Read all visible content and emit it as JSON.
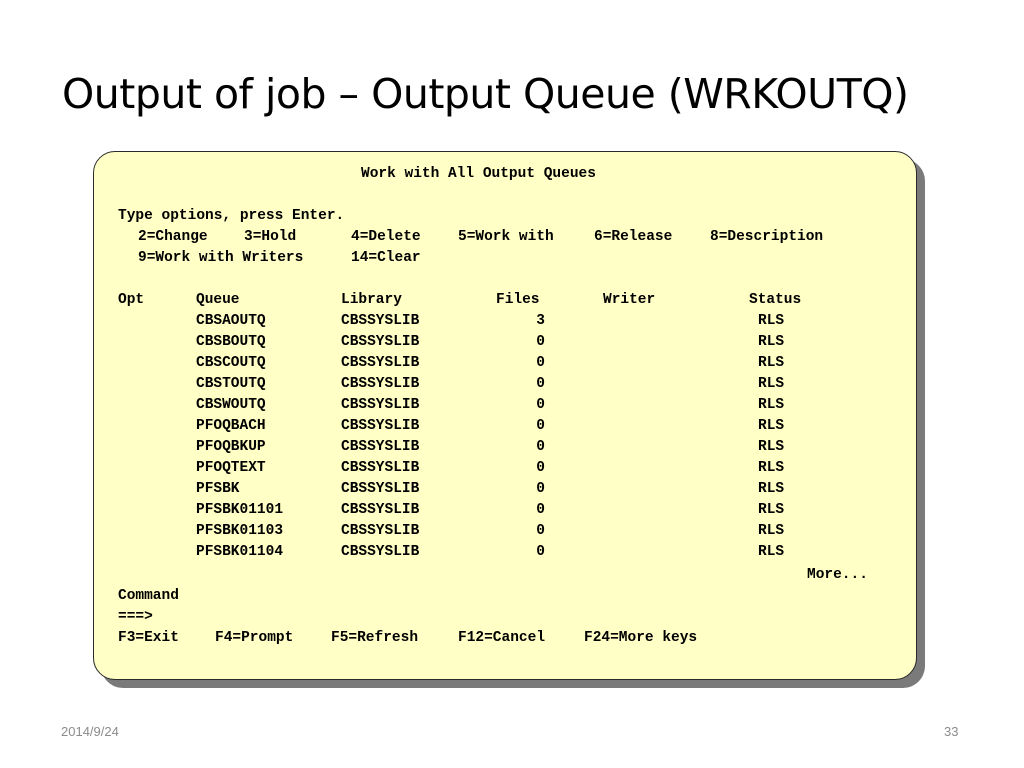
{
  "slide": {
    "title": "Output of job – Output Queue (WRKOUTQ)",
    "date": "2014/9/24",
    "page_number": "33"
  },
  "screen": {
    "title": "Work with All Output Queues",
    "instructions": "Type options, press Enter.",
    "options_line1": [
      "2=Change",
      "3=Hold",
      "4=Delete",
      "5=Work with",
      "6=Release",
      "8=Description"
    ],
    "options_line2": [
      "9=Work with Writers",
      "14=Clear"
    ],
    "columns": {
      "opt": "Opt",
      "queue": "Queue",
      "library": "Library",
      "files": "Files",
      "writer": "Writer",
      "status": "Status"
    },
    "rows": [
      {
        "queue": "CBSAOUTQ",
        "library": "CBSSYSLIB",
        "files": "3",
        "writer": "",
        "status": "RLS"
      },
      {
        "queue": "CBSBOUTQ",
        "library": "CBSSYSLIB",
        "files": "0",
        "writer": "",
        "status": "RLS"
      },
      {
        "queue": "CBSCOUTQ",
        "library": "CBSSYSLIB",
        "files": "0",
        "writer": "",
        "status": "RLS"
      },
      {
        "queue": "CBSTOUTQ",
        "library": "CBSSYSLIB",
        "files": "0",
        "writer": "",
        "status": "RLS"
      },
      {
        "queue": "CBSWOUTQ",
        "library": "CBSSYSLIB",
        "files": "0",
        "writer": "",
        "status": "RLS"
      },
      {
        "queue": "PFOQBACH",
        "library": "CBSSYSLIB",
        "files": "0",
        "writer": "",
        "status": "RLS"
      },
      {
        "queue": "PFOQBKUP",
        "library": "CBSSYSLIB",
        "files": "0",
        "writer": "",
        "status": "RLS"
      },
      {
        "queue": "PFOQTEXT",
        "library": "CBSSYSLIB",
        "files": "0",
        "writer": "",
        "status": "RLS"
      },
      {
        "queue": "PFSBK",
        "library": "CBSSYSLIB",
        "files": "0",
        "writer": "",
        "status": "RLS"
      },
      {
        "queue": "PFSBK01101",
        "library": "CBSSYSLIB",
        "files": "0",
        "writer": "",
        "status": "RLS"
      },
      {
        "queue": "PFSBK01103",
        "library": "CBSSYSLIB",
        "files": "0",
        "writer": "",
        "status": "RLS"
      },
      {
        "queue": "PFSBK01104",
        "library": "CBSSYSLIB",
        "files": "0",
        "writer": "",
        "status": "RLS"
      }
    ],
    "more_indicator": "More...",
    "command_label": "Command",
    "command_prompt": "===>",
    "command_value": "",
    "function_keys": [
      "F3=Exit",
      "F4=Prompt",
      "F5=Refresh",
      "F12=Cancel",
      "F24=More keys"
    ]
  }
}
